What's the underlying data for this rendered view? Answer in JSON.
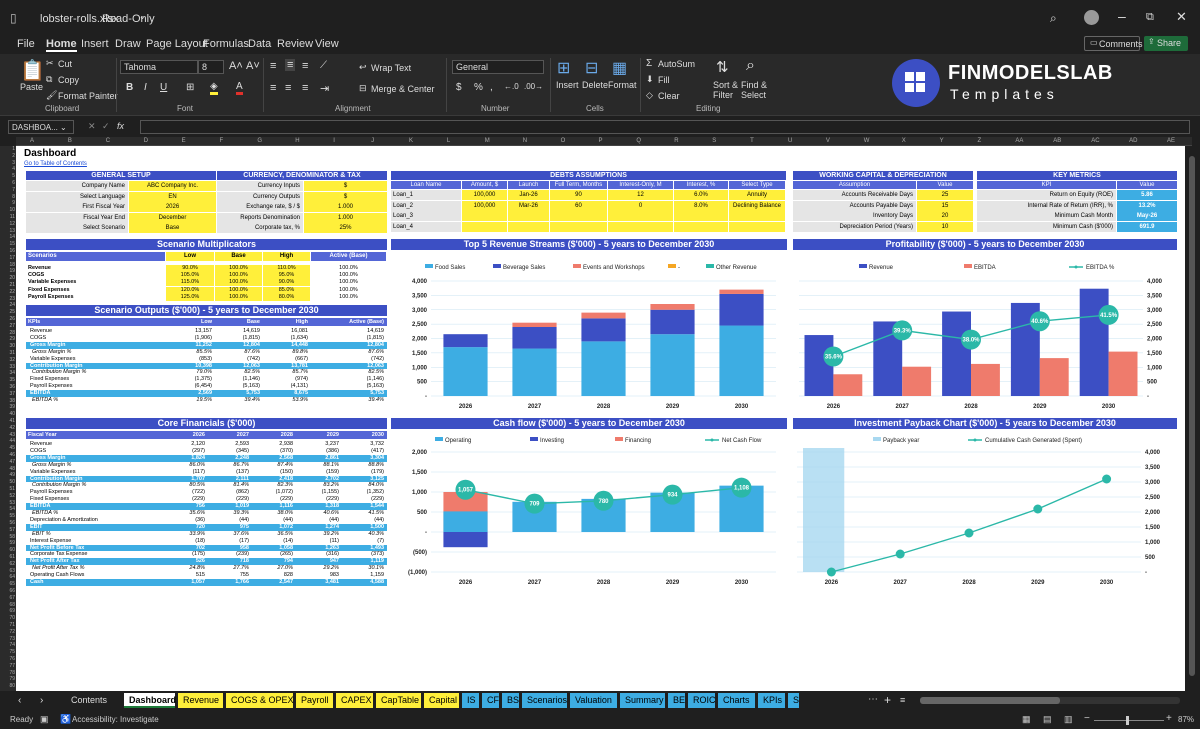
{
  "window": {
    "title": "lobster-rolls.xlsx",
    "mode": "Read-Only"
  },
  "menu": [
    "File",
    "Home",
    "Insert",
    "Draw",
    "Page Layout",
    "Formulas",
    "Data",
    "Review",
    "View"
  ],
  "active_menu": "Home",
  "actions": {
    "comments": "Comments",
    "share": "Share"
  },
  "ribbon": {
    "paste": "Paste",
    "cut": "Cut",
    "copy": "Copy",
    "format_painter": "Format Painter",
    "clipboard": "Clipboard",
    "font_name": "Tahoma",
    "font_size": "8",
    "font": "Font",
    "wrap_text": "Wrap Text",
    "merge_center": "Merge & Center",
    "alignment": "Alignment",
    "number_format": "General",
    "number": "Number",
    "insert": "Insert",
    "delete": "Delete",
    "format": "Format",
    "cells": "Cells",
    "autosum": "AutoSum",
    "fill": "Fill",
    "clear": "Clear",
    "sort_filter": "Sort & Filter",
    "find_select": "Find & Select",
    "editing": "Editing"
  },
  "brand": {
    "name": "FINMODELSLAB",
    "sub": "Templates"
  },
  "formula_bar": {
    "name_box": "DASHBOA...",
    "fx": "fx"
  },
  "columns": [
    "A",
    "B",
    "C",
    "D",
    "E",
    "F",
    "G",
    "H",
    "I",
    "J",
    "K",
    "L",
    "M",
    "N",
    "O",
    "P",
    "Q",
    "R",
    "S",
    "T",
    "U",
    "V",
    "W",
    "X",
    "Y",
    "Z",
    "AA",
    "AB",
    "AC",
    "AD",
    "AE"
  ],
  "sheet": {
    "title": "Dashboard",
    "toc_link": "Go to Table of Contents",
    "general": {
      "title": "GENERAL SETUP",
      "rows": [
        [
          "Company Name",
          "ABC Company Inc."
        ],
        [
          "Select Language",
          "EN"
        ],
        [
          "First Fiscal Year",
          "2026"
        ],
        [
          "Fiscal Year End",
          "December"
        ],
        [
          "Select Scenario",
          "Base"
        ]
      ]
    },
    "currency": {
      "title": "CURRENCY, DENOMINATOR & TAX",
      "rows": [
        [
          "Currency Inputs",
          "$"
        ],
        [
          "Currency Outputs",
          "$"
        ],
        [
          "Exchange rate, $ / $",
          "1.000"
        ],
        [
          "Reports Denomination",
          "1.000"
        ],
        [
          "Corporate tax, %",
          "25%"
        ]
      ]
    },
    "debts": {
      "title": "DEBTS ASSUMPTIONS",
      "headers": [
        "Loan Name",
        "Amount, $",
        "Launch",
        "Full Term, Months",
        "Interest-Only, M",
        "Interest, %",
        "Select Type"
      ],
      "rows": [
        [
          "Loan_1",
          "100,000",
          "Jan-26",
          "90",
          "12",
          "6.0%",
          "Annuity"
        ],
        [
          "Loan_2",
          "100,000",
          "Mar-26",
          "60",
          "0",
          "8.0%",
          "Declining Balance"
        ],
        [
          "Loan_3",
          "",
          "",
          "",
          "",
          "",
          ""
        ],
        [
          "Loan_4",
          "",
          "",
          "",
          "",
          "",
          ""
        ]
      ]
    },
    "wc": {
      "title": "WORKING CAPITAL & DEPRECIATION",
      "headers": [
        "Assumption",
        "Value"
      ],
      "rows": [
        [
          "Accounts Receivable Days",
          "25"
        ],
        [
          "Accounts Payable Days",
          "15"
        ],
        [
          "Inventory Days",
          "20"
        ],
        [
          "Depreciation Period (Years)",
          "10"
        ]
      ]
    },
    "kpi": {
      "title": "KEY METRICS",
      "headers": [
        "KPI",
        "Value"
      ],
      "rows": [
        [
          "Return on Equity (ROE)",
          "5.86"
        ],
        [
          "Internal Rate of Return (IRR), %",
          "13.2%"
        ],
        [
          "Minimum Cash Month",
          "May-26"
        ],
        [
          "Minimum Cash ($'000)",
          "691.9"
        ]
      ]
    },
    "multipliers": {
      "title": "Scenario Multiplicators",
      "headers": [
        "Scenarios",
        "Low",
        "Base",
        "High",
        "Active (Base)"
      ],
      "rows": [
        [
          "Revenue",
          "90.0%",
          "100.0%",
          "110.0%",
          "100.0%"
        ],
        [
          "COGS",
          "105.0%",
          "100.0%",
          "95.0%",
          "100.0%"
        ],
        [
          "Variable Expenses",
          "115.0%",
          "100.0%",
          "90.0%",
          "100.0%"
        ],
        [
          "Fixed Expenses",
          "120.0%",
          "100.0%",
          "85.0%",
          "100.0%"
        ],
        [
          "Payroll Expenses",
          "125.0%",
          "100.0%",
          "80.0%",
          "100.0%"
        ]
      ]
    },
    "outputs": {
      "title": "Scenario Outputs ($'000) - 5 years to December 2030",
      "headers": [
        "KPIs",
        "Low",
        "Base",
        "High",
        "Active (Base)"
      ],
      "rows": [
        [
          "Revenue",
          "13,157",
          "14,619",
          "16,081",
          "14,619",
          ""
        ],
        [
          "COGS",
          "(1,906)",
          "(1,815)",
          "(1,634)",
          "(1,815)",
          ""
        ],
        [
          "Gross Margin",
          "11,252",
          "12,804",
          "14,448",
          "12,804",
          "band"
        ],
        [
          "Gross Margin %",
          "85.5%",
          "87.6%",
          "89.8%",
          "87.6%",
          "ital"
        ],
        [
          "Variable Expenses",
          "(853)",
          "(742)",
          "(667)",
          "(742)",
          ""
        ],
        [
          "Contribution Margin",
          "10,398",
          "12,063",
          "13,781",
          "12,063",
          "band"
        ],
        [
          "Contribution Margin %",
          "79.0%",
          "82.5%",
          "85.7%",
          "82.5%",
          "ital"
        ],
        [
          "Fixed Expenses",
          "(1,375)",
          "(1,146)",
          "(974)",
          "(1,146)",
          ""
        ],
        [
          "Payroll Expenses",
          "(6,454)",
          "(5,163)",
          "(4,131)",
          "(5,163)",
          ""
        ],
        [
          "EBITDA",
          "2,569",
          "5,753",
          "8,675",
          "5,753",
          "band"
        ],
        [
          "EBITDA %",
          "19.5%",
          "39.4%",
          "53.9%",
          "39.4%",
          "ital"
        ]
      ]
    },
    "core": {
      "title": "Core Financials ($'000)",
      "headers": [
        "Fiscal Year",
        "2026",
        "2027",
        "2028",
        "2029",
        "2030"
      ],
      "rows": [
        [
          "Revenue",
          "2,120",
          "2,593",
          "2,938",
          "3,237",
          "3,732",
          ""
        ],
        [
          "COGS",
          "(297)",
          "(345)",
          "(370)",
          "(386)",
          "(417)",
          ""
        ],
        [
          "Gross Margin",
          "1,824",
          "2,248",
          "2,568",
          "2,861",
          "3,304",
          "band"
        ],
        [
          "Gross Margin %",
          "86.0%",
          "86.7%",
          "87.4%",
          "88.1%",
          "88.8%",
          "ital"
        ],
        [
          "Variable Expenses",
          "(117)",
          "(137)",
          "(150)",
          "(159)",
          "(179)",
          ""
        ],
        [
          "Contribution Margin",
          "1,707",
          "2,111",
          "2,418",
          "2,702",
          "3,125",
          "band"
        ],
        [
          "Contribution Margin %",
          "80.5%",
          "81.4%",
          "82.3%",
          "83.2%",
          "84.0%",
          "ital"
        ],
        [
          "Payroll Expenses",
          "(722)",
          "(862)",
          "(1,072)",
          "(1,155)",
          "(1,352)",
          ""
        ],
        [
          "Fixed Expenses",
          "(229)",
          "(229)",
          "(229)",
          "(229)",
          "(229)",
          ""
        ],
        [
          "EBITDA",
          "756",
          "1,019",
          "1,116",
          "1,318",
          "1,544",
          "band"
        ],
        [
          "EBITDA %",
          "35.6%",
          "39.3%",
          "38.0%",
          "40.6%",
          "41.5%",
          "ital"
        ],
        [
          "Depreciation & Amortization",
          "(36)",
          "(44)",
          "(44)",
          "(44)",
          "(44)",
          ""
        ],
        [
          "EBIT",
          "720",
          "975",
          "1,072",
          "1,274",
          "1,500",
          "band"
        ],
        [
          "EBIT %",
          "33.9%",
          "37.6%",
          "36.5%",
          "39.2%",
          "40.3%",
          "ital"
        ],
        [
          "Interest Expense",
          "(18)",
          "(17)",
          "(14)",
          "(11)",
          "(7)",
          ""
        ],
        [
          "Net Profit Before Tax",
          "702",
          "958",
          "1,058",
          "1,263",
          "1,493",
          "band"
        ],
        [
          "Corporate Tax Expense",
          "(175)",
          "(239)",
          "(265)",
          "(316)",
          "(373)",
          ""
        ],
        [
          "Net Profit After Tax",
          "526",
          "718",
          "794",
          "947",
          "1,119",
          "band"
        ],
        [
          "Net Profit After Tax %",
          "24.8%",
          "27.7%",
          "27.0%",
          "29.2%",
          "30.1%",
          "ital"
        ],
        [
          "Operating Cash Flows",
          "515",
          "755",
          "828",
          "983",
          "1,159",
          ""
        ],
        [
          "Cash",
          "1,057",
          "1,766",
          "2,547",
          "3,481",
          "4,588",
          "band"
        ]
      ]
    }
  },
  "chart_data": [
    {
      "type": "bar",
      "title": "Top 5 Revenue Streams ($'000) - 5 years to December 2030",
      "categories": [
        "2026",
        "2027",
        "2028",
        "2029",
        "2030"
      ],
      "series": [
        {
          "name": "Food Sales",
          "values": [
            1700,
            1650,
            1900,
            2150,
            2450
          ],
          "color": "#3dade3"
        },
        {
          "name": "Beverage Sales",
          "values": [
            450,
            750,
            800,
            850,
            1100
          ],
          "color": "#3c4fc4"
        },
        {
          "name": "Events and Workshops",
          "values": [
            0,
            150,
            200,
            200,
            150
          ],
          "color": "#ef7b6c"
        },
        {
          "name": "-",
          "values": [
            0,
            0,
            0,
            0,
            0
          ],
          "color": "#f5a623"
        },
        {
          "name": "Other Revenue",
          "values": [
            0,
            0,
            0,
            0,
            0
          ],
          "color": "#2bb8a8"
        }
      ],
      "ylim": [
        0,
        4000
      ],
      "ticks": [
        "-",
        "500",
        "1,000",
        "1,500",
        "2,000",
        "2,500",
        "3,000",
        "3,500",
        "4,000"
      ],
      "stacked": true
    },
    {
      "type": "bar",
      "title": "Profitability ($'000) - 5 years to December 2030",
      "categories": [
        "2026",
        "2027",
        "2028",
        "2029",
        "2030"
      ],
      "series": [
        {
          "name": "Revenue",
          "values": [
            2120,
            2593,
            2938,
            3237,
            3732
          ],
          "color": "#3c4fc4"
        },
        {
          "name": "EBITDA",
          "values": [
            756,
            1019,
            1116,
            1318,
            1544
          ],
          "color": "#ef7b6c"
        },
        {
          "name": "EBITDA %",
          "values": [
            35.6,
            39.3,
            38.0,
            40.6,
            41.5
          ],
          "labels": [
            "35.6%",
            "39.3%",
            "38.0%",
            "40.6%",
            "41.5%"
          ],
          "color": "#2bb8a8"
        }
      ],
      "ylim": [
        0,
        4000
      ],
      "ticks": [
        "-",
        "500",
        "1,000",
        "1,500",
        "2,000",
        "2,500",
        "3,000",
        "3,500",
        "4,000"
      ]
    },
    {
      "type": "bar",
      "title": "Cash flow ($'000) - 5 years to December 2030",
      "categories": [
        "2026",
        "2027",
        "2028",
        "2029",
        "2030"
      ],
      "series": [
        {
          "name": "Operating",
          "values": [
            515,
            755,
            828,
            983,
            1159
          ],
          "color": "#3dade3"
        },
        {
          "name": "Investing",
          "values": [
            -380,
            0,
            0,
            0,
            0
          ],
          "color": "#3c4fc4"
        },
        {
          "name": "Financing",
          "values": [
            1000,
            0,
            0,
            0,
            0
          ],
          "color": "#ef7b6c"
        },
        {
          "name": "Net Cash Flow",
          "values": [
            1057,
            709,
            780,
            934,
            1108
          ],
          "labels": [
            "1,057",
            "709",
            "780",
            "934",
            "1,108"
          ],
          "color": "#2bb8a8"
        }
      ],
      "ylim": [
        -1000,
        2000
      ],
      "ticks": [
        "(1,000)",
        "(500)",
        "-",
        "500",
        "1,000",
        "1,500",
        "2,000"
      ],
      "stacked": true
    },
    {
      "type": "line",
      "title": "Investment Payback Chart ($'000) - 5 years to December 2030",
      "categories": [
        "2026",
        "2027",
        "2028",
        "2029",
        "2030"
      ],
      "series": [
        {
          "name": "Payback year",
          "values": [
            1,
            0,
            0,
            0,
            0
          ],
          "color": "#a8d8f0"
        },
        {
          "name": "Cumulative Cash Generated (Spent)",
          "values": [
            0,
            600,
            1300,
            2100,
            3100
          ],
          "color": "#2bb8a8"
        }
      ],
      "ylim": [
        0,
        4000
      ],
      "ticks": [
        "-",
        "500",
        "1,000",
        "1,500",
        "2,000",
        "2,500",
        "3,000",
        "3,500",
        "4,000"
      ]
    }
  ],
  "tabs": [
    {
      "name": "Contents",
      "color": "#1f1f1f",
      "fg": "#ddd"
    },
    {
      "name": "Dashboard",
      "color": "#ffffff",
      "fg": "#000",
      "active": true
    },
    {
      "name": "Revenue",
      "color": "#ffef3a"
    },
    {
      "name": "COGS & OPEX",
      "color": "#ffef3a"
    },
    {
      "name": "Payroll",
      "color": "#ffef3a"
    },
    {
      "name": "CAPEX",
      "color": "#ffef3a"
    },
    {
      "name": "CapTable",
      "color": "#ffef3a"
    },
    {
      "name": "Capital",
      "color": "#ffef3a"
    },
    {
      "name": "IS",
      "color": "#3dade3"
    },
    {
      "name": "CF",
      "color": "#3dade3"
    },
    {
      "name": "BS",
      "color": "#3dade3"
    },
    {
      "name": "Scenarios",
      "color": "#3dade3"
    },
    {
      "name": "Valuation",
      "color": "#3dade3"
    },
    {
      "name": "Summary",
      "color": "#3dade3"
    },
    {
      "name": "BE",
      "color": "#3dade3"
    },
    {
      "name": "ROIC",
      "color": "#3dade3"
    },
    {
      "name": "Charts",
      "color": "#3dade3"
    },
    {
      "name": "KPIs",
      "color": "#3dade3"
    },
    {
      "name": "S",
      "color": "#3dade3"
    }
  ],
  "status": {
    "ready": "Ready",
    "accessibility": "Accessibility: Investigate",
    "zoom": "87%"
  }
}
